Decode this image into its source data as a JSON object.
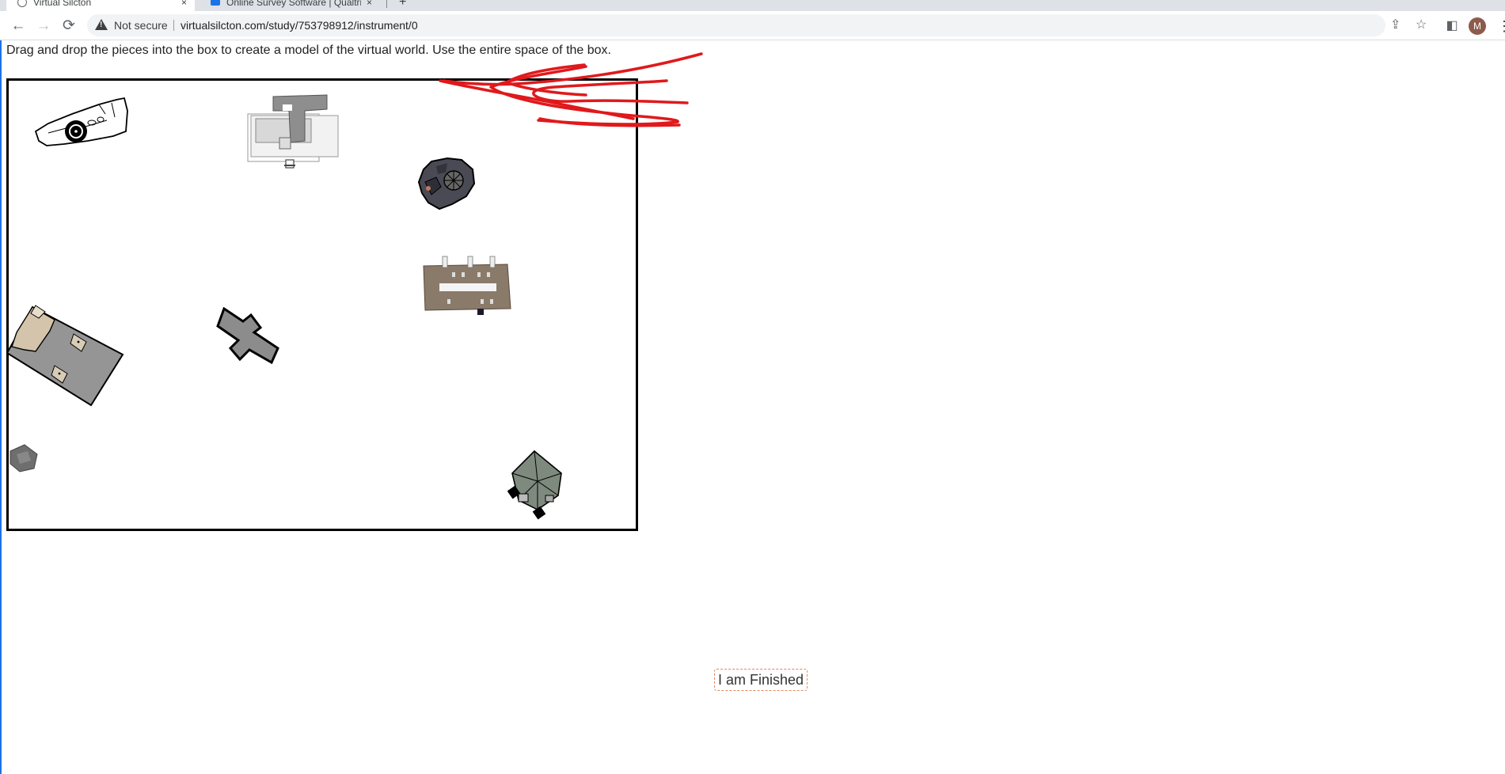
{
  "browser": {
    "tabs": [
      {
        "label": "Virtual Silcton",
        "close": "×"
      },
      {
        "label": "Online Survey Software | Qualtrics",
        "close": "×"
      }
    ],
    "new_tab": "+",
    "back": "←",
    "forward": "→",
    "reload": "⟳",
    "security_label": "Not secure",
    "url": "virtualsilcton.com/study/753798912/instrument/0",
    "share": "⇪",
    "star": "☆",
    "side_panel": "◧",
    "profile_initial": "M",
    "menu": "⋮"
  },
  "page": {
    "instructions": "Drag and drop the pieces into the box to create a model of the virtual world. Use the entire space of the box.",
    "finish_button": "I am Finished"
  },
  "pieces": [
    {
      "name": "piece-white-building-with-circle"
    },
    {
      "name": "piece-gray-t-building"
    },
    {
      "name": "piece-dark-octagonal-building"
    },
    {
      "name": "piece-brown-rectangular-building"
    },
    {
      "name": "piece-tan-tilted-building"
    },
    {
      "name": "piece-gray-cross-building"
    },
    {
      "name": "piece-small-gray-building"
    },
    {
      "name": "piece-gray-pyramid-roof-building"
    }
  ],
  "colors": {
    "scribble": "#e0191c",
    "box_border": "#000000",
    "finish_border": "#e08a60"
  }
}
